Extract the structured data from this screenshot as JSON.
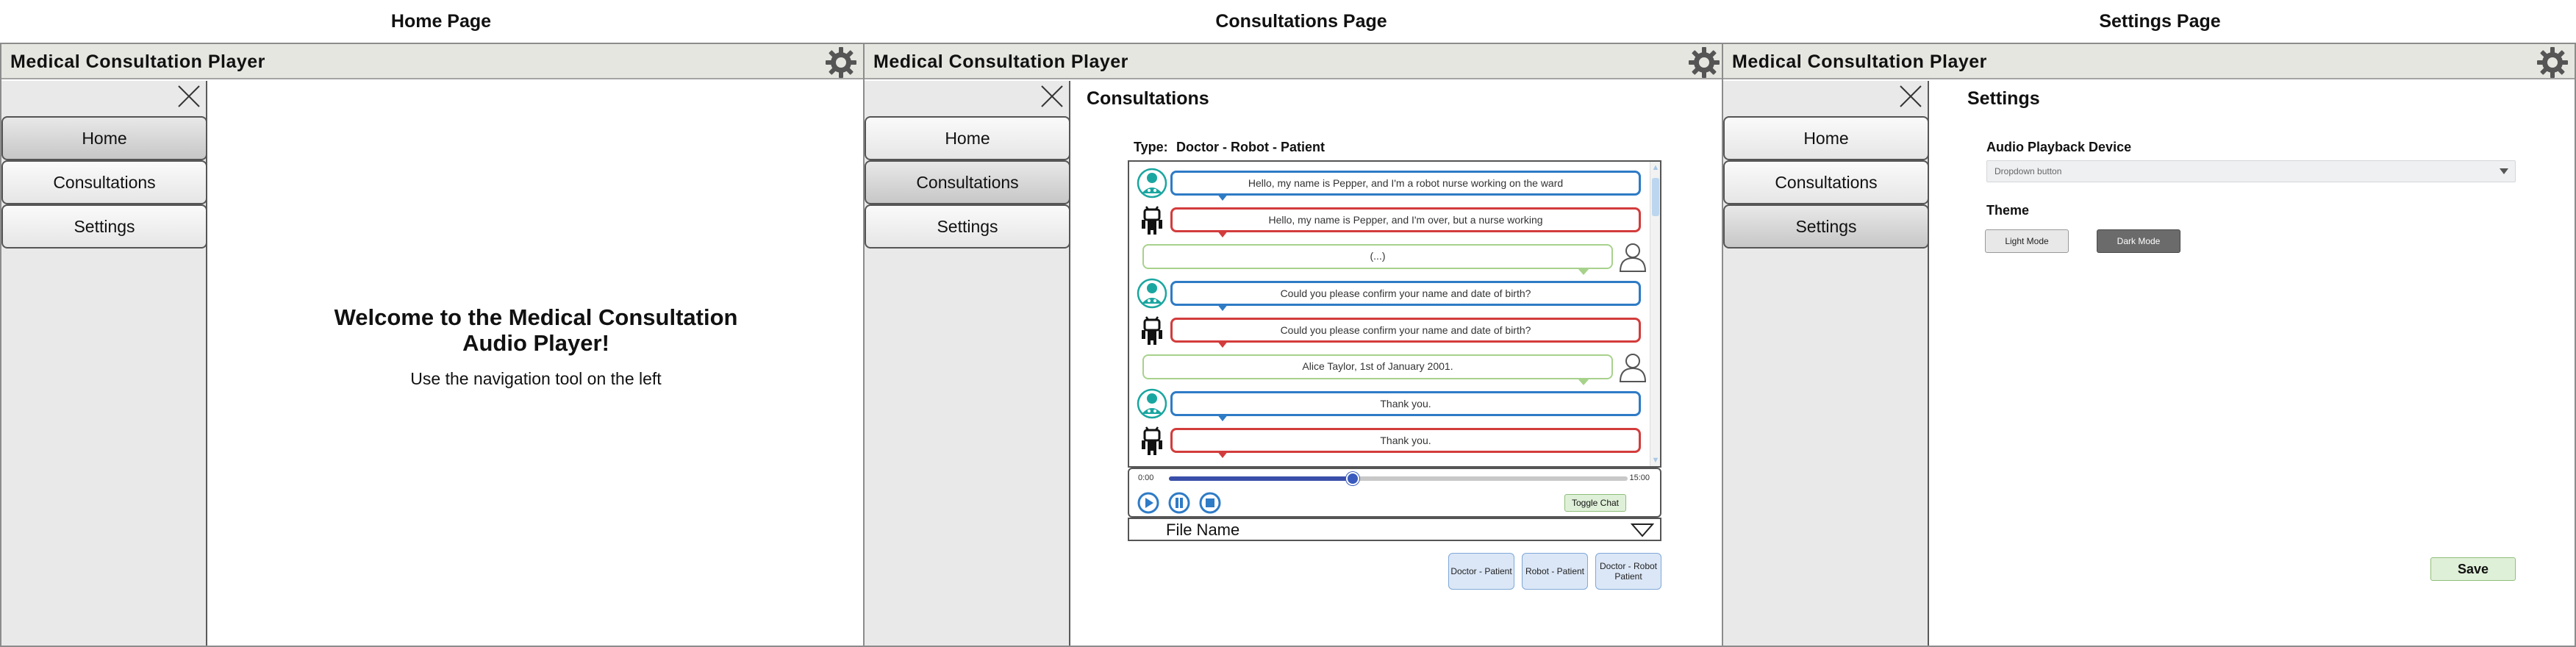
{
  "captions": {
    "home": "Home Page",
    "consultations": "Consultations Page",
    "settings": "Settings Page"
  },
  "app": {
    "title": "Medical Consultation Player",
    "icons": [
      "gear-icon",
      "close-icon"
    ]
  },
  "nav": {
    "home": "Home",
    "consultations": "Consultations",
    "settings": "Settings"
  },
  "home": {
    "welcome_title": "Welcome to the Medical Consultation Audio Player!",
    "welcome_subtitle": "Use the navigation tool on the left"
  },
  "consultations": {
    "title": "Consultations",
    "type_label": "Type:",
    "type_value": "Doctor - Robot - Patient",
    "messages": [
      {
        "speaker": "doctor",
        "text": "Hello, my name is Pepper, and I'm a robot nurse working on the ward"
      },
      {
        "speaker": "robot",
        "text": "Hello, my name is Pepper, and I'm over, but a nurse working"
      },
      {
        "speaker": "patient",
        "text": "(...)"
      },
      {
        "speaker": "doctor",
        "text": "Could you please confirm your name and date of birth?"
      },
      {
        "speaker": "robot",
        "text": "Could you please confirm your name and date of birth?"
      },
      {
        "speaker": "patient",
        "text": "Alice Taylor, 1st of January 2001."
      },
      {
        "speaker": "doctor",
        "text": "Thank you."
      },
      {
        "speaker": "robot",
        "text": "Thank you."
      }
    ],
    "player": {
      "time_start": "0:00",
      "time_end": "15:00",
      "progress_fraction": 0.4,
      "toggle_chat": "Toggle Chat",
      "controls": [
        "play-icon",
        "pause-icon",
        "stop-icon"
      ]
    },
    "file_name": "File Name",
    "mode_buttons": [
      "Doctor - Patient",
      "Robot - Patient",
      "Doctor - Robot Patient"
    ],
    "colors": {
      "doctor": "#2e7bc6",
      "robot": "#d33c3c",
      "patient": "#a7d28c",
      "avatar_teal": "#1aa6a0"
    }
  },
  "settings": {
    "title": "Settings",
    "audio_label": "Audio Playback Device",
    "dropdown_placeholder": "Dropdown button",
    "theme_label": "Theme",
    "light_mode": "Light Mode",
    "dark_mode": "Dark Mode",
    "save": "Save"
  }
}
